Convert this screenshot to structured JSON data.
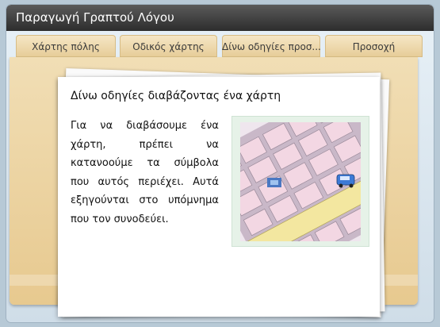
{
  "window": {
    "title": "Παραγωγή Γραπτού Λόγου"
  },
  "tabs": [
    {
      "label": "Χάρτης πόλης"
    },
    {
      "label": "Οδικός χάρτης"
    },
    {
      "label": "Δίνω οδηγίες προσ..."
    },
    {
      "label": "Προσοχή"
    }
  ],
  "card": {
    "title": "Δίνω οδηγίες διαβάζοντας ένα χάρτη",
    "text": "Για να διαβάσουμε ένα χάρτη, πρέπει να κατανοούμε τα σύμβολα που αυτός περιέχει. Αυτά εξηγούνται στο υπόμνημα που τον συνοδεύει."
  },
  "colors": {
    "title_bar": "#3b3b3b",
    "tab_fill": "#eed9ad",
    "board_fill": "#ecd6a4",
    "map_background": "#e6f2e8",
    "map_blocks": "#f3d7e3",
    "main_road": "#f3e7a0"
  }
}
